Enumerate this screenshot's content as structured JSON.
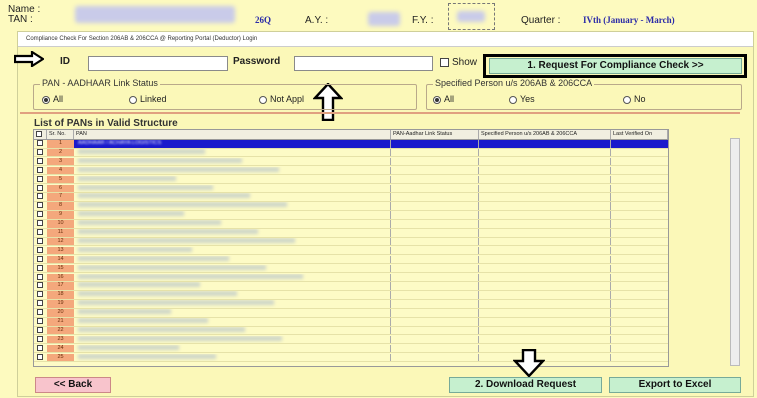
{
  "header": {
    "name_label": "Name :",
    "tan_label": "TAN :",
    "form": "26Q",
    "ay_label": "A.Y. :",
    "fy_label": "F.Y. :",
    "quarter_label": "Quarter :",
    "quarter_value": "IVth (January - March)"
  },
  "window_title": "Compliance Check For Section 206AB & 206CCA @ Reporting Portal (Deductor) Login",
  "login": {
    "user_id_label": "ID",
    "password_label": "Password",
    "show_label": "Show",
    "request_button": "1. Request For Compliance Check >>"
  },
  "pan_aadhaar": {
    "title": "PAN - AADHAAR Link Status",
    "options": [
      "All",
      "Linked",
      "Not Appl"
    ],
    "selected": "All"
  },
  "specified_person": {
    "title": "Specified Person u/s 206AB & 206CCA",
    "options": [
      "All",
      "Yes",
      "No"
    ],
    "selected": "All"
  },
  "list": {
    "title": "List of PANs in Valid Structure",
    "columns": [
      "Sr. No.",
      "PAN",
      "PAN-Aadhar Link Status",
      "Specified Person u/s 206AB & 206CCA",
      "Last Verified On"
    ],
    "rows": [
      "1",
      "2",
      "3",
      "4",
      "5",
      "6",
      "7",
      "8",
      "9",
      "10",
      "11",
      "12",
      "13",
      "14",
      "15",
      "16",
      "17",
      "18",
      "19",
      "20",
      "21",
      "22",
      "23",
      "24",
      "25"
    ],
    "selected_row_text": "AADHAAR / ACHAYA LOGISTICS"
  },
  "footer": {
    "back_button": "<< Back",
    "download_button": "2. Download Request",
    "export_button": "Export to Excel"
  },
  "colors": {
    "background": "#fdfabf",
    "accent_blue": "#2a2aa8",
    "button_green": "#c6f0cf",
    "button_pink": "#f8c4cc",
    "selected_row": "#1a1acc",
    "sr_no_orange": "#f4a87c"
  }
}
